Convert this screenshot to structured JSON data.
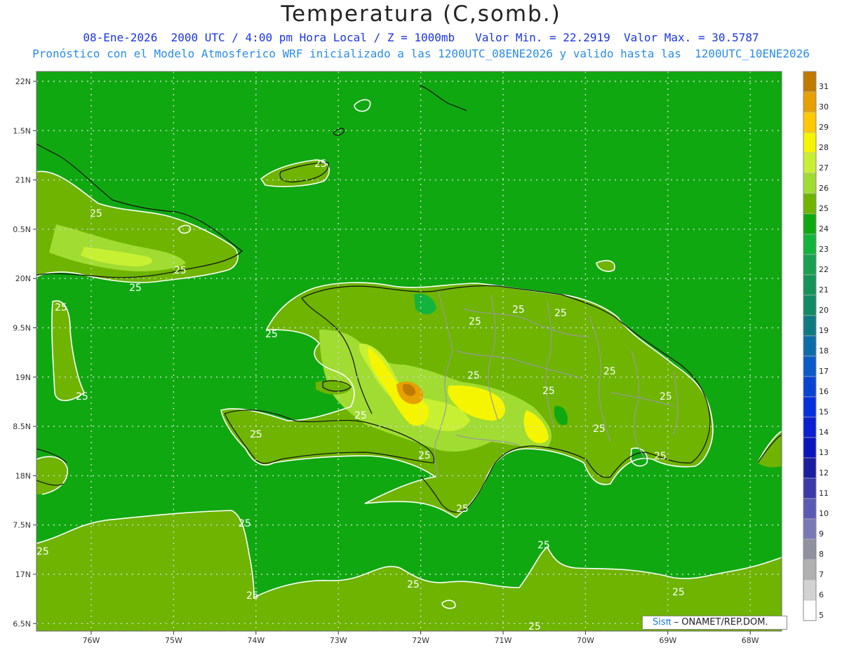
{
  "title": "Temperatura (C,somb.)",
  "subtitle_1": "08-Ene-2026  2000 UTC / 4:00 pm Hora Local / Z = 1000mb   Valor Min. = 22.2919  Valor Max. = 30.5787",
  "subtitle_2": "Pronóstico con el Modelo Atmosferico WRF inicializado a las 1200UTC_08ENE2026 y valido hasta las  1200UTC_10ENE2026",
  "credit": {
    "logo_text": "Sisπ",
    "text": " – ONAMET/REP.DOM."
  },
  "map": {
    "lat_ticks": [
      "22N",
      "1.5N",
      "21N",
      "0.5N",
      "20N",
      "9.5N",
      "19N",
      "8.5N",
      "18N",
      "7.5N",
      "17N",
      "6.5N"
    ],
    "lon_ticks": [
      "76W",
      "75W",
      "74W",
      "73W",
      "72W",
      "71W",
      "70W",
      "69W",
      "68W"
    ],
    "contour_label": "25",
    "base_color": "#10a810"
  },
  "colorbar": {
    "levels": [
      "31",
      "30",
      "29",
      "28",
      "27",
      "26",
      "25",
      "24",
      "23",
      "22",
      "21",
      "20",
      "19",
      "18",
      "17",
      "16",
      "15",
      "14",
      "13",
      "12",
      "11",
      "10",
      "9",
      "8",
      "7",
      "6",
      "5"
    ],
    "colors": [
      "#c07a00",
      "#e6a000",
      "#ffc800",
      "#f5f500",
      "#c8f032",
      "#a0dc32",
      "#6eb400",
      "#10a810",
      "#14b43c",
      "#1aa050",
      "#169458",
      "#128a64",
      "#107a82",
      "#0c6ca8",
      "#0a5ac8",
      "#0844d2",
      "#0630dc",
      "#0a1ed2",
      "#0a14be",
      "#1a1ea0",
      "#3a3aaa",
      "#5a5ab4",
      "#7a78b4",
      "#9090a0",
      "#b0b0b0",
      "#d2d2d2",
      "#ffffff"
    ]
  }
}
